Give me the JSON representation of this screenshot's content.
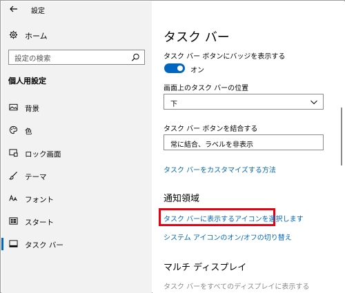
{
  "window": {
    "title": "設定"
  },
  "sidebar": {
    "home_label": "ホーム",
    "search_placeholder": "設定の検索",
    "section_heading": "個人用設定",
    "items": [
      {
        "label": "背景",
        "icon": "image-icon"
      },
      {
        "label": "色",
        "icon": "palette-icon"
      },
      {
        "label": "ロック画面",
        "icon": "lock-screen-icon"
      },
      {
        "label": "テーマ",
        "icon": "theme-brush-icon"
      },
      {
        "label": "フォント",
        "icon": "font-icon"
      },
      {
        "label": "スタート",
        "icon": "start-icon"
      },
      {
        "label": "タスク バー",
        "icon": "taskbar-icon"
      }
    ],
    "selected_index": 6
  },
  "main": {
    "title": "タスク バー",
    "badge_setting_label": "タスク バー ボタンにバッジを表示する",
    "badge_toggle_state": "オン",
    "position_label": "画面上のタスク バーの位置",
    "position_value": "下",
    "combine_label": "タスク バー ボタンを結合する",
    "combine_value": "常に結合、ラベルを非表示",
    "customize_link": "タスク バーをカスタマイズする方法",
    "notification_heading": "通知領域",
    "select_icons_link": "タスク バーに表示するアイコンを選択します",
    "system_icons_link": "システム アイコンのオン/オフの切り替え",
    "multi_display_heading": "マルチ ディスプレイ",
    "multi_display_setting": "タスク バーをすべてのディスプレイに表示する"
  },
  "colors": {
    "accent": "#0067c0",
    "highlight_border": "#e60012",
    "sidebar_bg": "#f2f2f2"
  }
}
